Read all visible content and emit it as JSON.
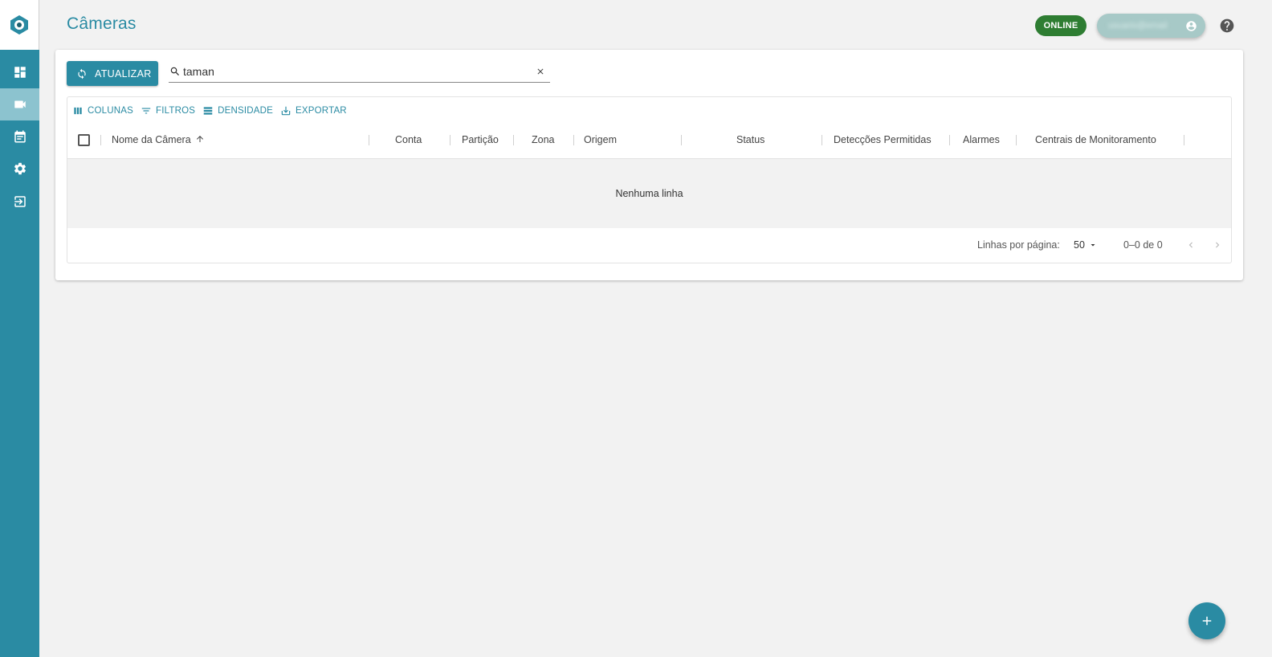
{
  "page": {
    "title": "Câmeras"
  },
  "header": {
    "status_badge": "ONLINE",
    "user_name": "usuario@email"
  },
  "sidebar": {
    "items": [
      {
        "icon": "dashboard-icon",
        "active": false
      },
      {
        "icon": "camera-icon",
        "active": true
      },
      {
        "icon": "calendar-icon",
        "active": false
      },
      {
        "icon": "settings-icon",
        "active": false
      },
      {
        "icon": "logout-icon",
        "active": false
      }
    ]
  },
  "toolbar": {
    "refresh_label": "ATUALIZAR",
    "search_value": "taman"
  },
  "grid": {
    "tools": {
      "columns": "COLUNAS",
      "filters": "FILTROS",
      "density": "DENSIDADE",
      "export": "EXPORTAR"
    },
    "columns": [
      "Nome da Câmera",
      "Conta",
      "Partição",
      "Zona",
      "Origem",
      "Status",
      "Detecções Permitidas",
      "Alarmes",
      "Centrais de Monitoramento"
    ],
    "sort_column": "Nome da Câmera",
    "sort_direction": "asc",
    "empty_message": "Nenhuma linha",
    "pagination": {
      "rows_label": "Linhas por página:",
      "rows_per_page": "50",
      "range": "0–0 de 0"
    }
  },
  "colors": {
    "primary": "#2a8ba3",
    "online": "#2e7d32",
    "background": "#f2f2f2"
  }
}
